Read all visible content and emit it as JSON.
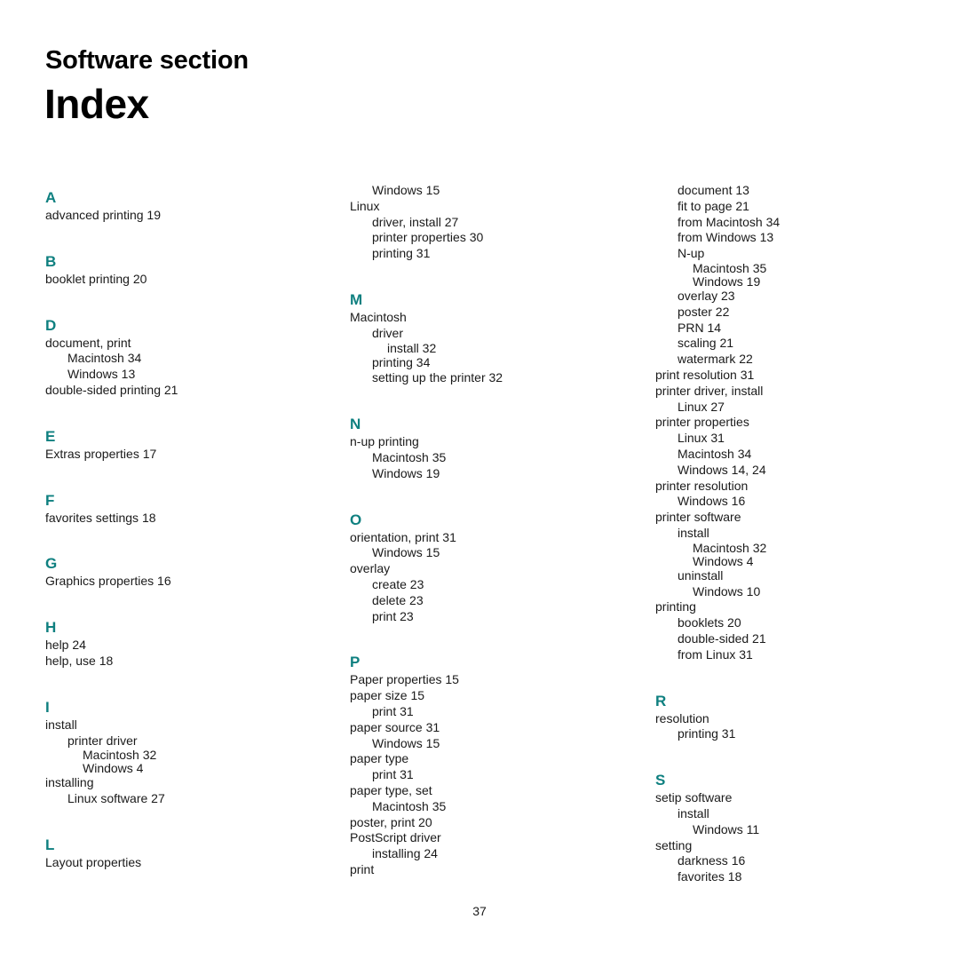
{
  "header": {
    "section_title": "Software section",
    "page_title": "Index"
  },
  "accent_color": "#0f8080",
  "columns": [
    {
      "blocks": [
        {
          "letter": "A",
          "gap_before": 0,
          "entries": [
            {
              "level": 1,
              "text": "advanced printing 19"
            }
          ]
        },
        {
          "letter": "B",
          "gap_before": 22,
          "entries": [
            {
              "level": 1,
              "text": "booklet printing 20"
            }
          ]
        },
        {
          "letter": "D",
          "gap_before": 22,
          "entries": [
            {
              "level": 1,
              "text": "document, print"
            },
            {
              "level": 2,
              "text": "Macintosh 34"
            },
            {
              "level": 2,
              "text": "Windows 13"
            },
            {
              "level": 1,
              "text": "double-sided printing 21"
            }
          ]
        },
        {
          "letter": "E",
          "gap_before": 22,
          "entries": [
            {
              "level": 1,
              "text": "Extras properties 17"
            }
          ]
        },
        {
          "letter": "F",
          "gap_before": 22,
          "entries": [
            {
              "level": 1,
              "text": "favorites settings 18"
            }
          ]
        },
        {
          "letter": "G",
          "gap_before": 22,
          "entries": [
            {
              "level": 1,
              "text": "Graphics properties 16"
            }
          ]
        },
        {
          "letter": "H",
          "gap_before": 22,
          "entries": [
            {
              "level": 1,
              "text": "help 24"
            },
            {
              "level": 1,
              "text": "help, use 18"
            }
          ]
        },
        {
          "letter": "I",
          "gap_before": 22,
          "entries": [
            {
              "level": 1,
              "text": "install"
            },
            {
              "level": 2,
              "text": "printer driver"
            },
            {
              "level": 3,
              "text": "Macintosh 32",
              "tight": true
            },
            {
              "level": 3,
              "text": "Windows 4",
              "tight": true
            },
            {
              "level": 1,
              "text": "installing"
            },
            {
              "level": 2,
              "text": "Linux software 27"
            }
          ]
        },
        {
          "letter": "L",
          "gap_before": 22,
          "entries": [
            {
              "level": 1,
              "text": "Layout properties"
            }
          ]
        }
      ]
    },
    {
      "blocks": [
        {
          "letter": "",
          "gap_before": 0,
          "entries": [
            {
              "level": 2,
              "text": "Windows 15"
            },
            {
              "level": 1,
              "text": "Linux"
            },
            {
              "level": 2,
              "text": "driver, install 27"
            },
            {
              "level": 2,
              "text": "printer properties 30"
            },
            {
              "level": 2,
              "text": "printing 31"
            }
          ]
        },
        {
          "letter": "M",
          "gap_before": 22,
          "entries": [
            {
              "level": 1,
              "text": "Macintosh"
            },
            {
              "level": 2,
              "text": "driver"
            },
            {
              "level": 3,
              "text": "install 32",
              "tight": true
            },
            {
              "level": 2,
              "text": "printing 34"
            },
            {
              "level": 2,
              "text": "setting up the printer 32"
            }
          ]
        },
        {
          "letter": "N",
          "gap_before": 22,
          "entries": [
            {
              "level": 1,
              "text": "n-up printing"
            },
            {
              "level": 2,
              "text": "Macintosh 35"
            },
            {
              "level": 2,
              "text": "Windows 19"
            }
          ]
        },
        {
          "letter": "O",
          "gap_before": 22,
          "entries": [
            {
              "level": 1,
              "text": "orientation, print 31"
            },
            {
              "level": 2,
              "text": "Windows 15"
            },
            {
              "level": 1,
              "text": "overlay"
            },
            {
              "level": 2,
              "text": "create 23"
            },
            {
              "level": 2,
              "text": "delete 23"
            },
            {
              "level": 2,
              "text": "print 23"
            }
          ]
        },
        {
          "letter": "P",
          "gap_before": 22,
          "entries": [
            {
              "level": 1,
              "text": "Paper properties 15"
            },
            {
              "level": 1,
              "text": "paper size 15"
            },
            {
              "level": 2,
              "text": "print 31"
            },
            {
              "level": 1,
              "text": "paper source 31"
            },
            {
              "level": 2,
              "text": "Windows 15"
            },
            {
              "level": 1,
              "text": "paper type"
            },
            {
              "level": 2,
              "text": "print 31"
            },
            {
              "level": 1,
              "text": "paper type, set"
            },
            {
              "level": 2,
              "text": "Macintosh 35"
            },
            {
              "level": 1,
              "text": "poster, print 20"
            },
            {
              "level": 1,
              "text": "PostScript driver"
            },
            {
              "level": 2,
              "text": "installing 24"
            },
            {
              "level": 1,
              "text": "print"
            }
          ]
        }
      ]
    },
    {
      "blocks": [
        {
          "letter": "",
          "gap_before": 0,
          "entries": [
            {
              "level": 2,
              "text": "document 13"
            },
            {
              "level": 2,
              "text": "fit to page 21"
            },
            {
              "level": 2,
              "text": "from Macintosh 34"
            },
            {
              "level": 2,
              "text": "from Windows 13"
            },
            {
              "level": 2,
              "text": "N-up"
            },
            {
              "level": 3,
              "text": "Macintosh 35",
              "tight": true
            },
            {
              "level": 3,
              "text": "Windows 19",
              "tight": true
            },
            {
              "level": 2,
              "text": "overlay 23"
            },
            {
              "level": 2,
              "text": "poster 22"
            },
            {
              "level": 2,
              "text": "PRN 14"
            },
            {
              "level": 2,
              "text": "scaling 21"
            },
            {
              "level": 2,
              "text": "watermark 22"
            },
            {
              "level": 1,
              "text": "print resolution 31"
            },
            {
              "level": 1,
              "text": "printer driver, install"
            },
            {
              "level": 2,
              "text": "Linux 27"
            },
            {
              "level": 1,
              "text": "printer properties"
            },
            {
              "level": 2,
              "text": "Linux 31"
            },
            {
              "level": 2,
              "text": "Macintosh 34"
            },
            {
              "level": 2,
              "text": "Windows 14, 24"
            },
            {
              "level": 1,
              "text": "printer resolution"
            },
            {
              "level": 2,
              "text": "Windows 16"
            },
            {
              "level": 1,
              "text": "printer software"
            },
            {
              "level": 2,
              "text": "install"
            },
            {
              "level": 3,
              "text": "Macintosh 32",
              "tight": true
            },
            {
              "level": 3,
              "text": "Windows 4",
              "tight": true
            },
            {
              "level": 2,
              "text": "uninstall"
            },
            {
              "level": 3,
              "text": "Windows 10"
            },
            {
              "level": 1,
              "text": "printing"
            },
            {
              "level": 2,
              "text": "booklets 20"
            },
            {
              "level": 2,
              "text": "double-sided 21"
            },
            {
              "level": 2,
              "text": "from Linux 31"
            }
          ]
        },
        {
          "letter": "R",
          "gap_before": 22,
          "entries": [
            {
              "level": 1,
              "text": "resolution"
            },
            {
              "level": 2,
              "text": "printing 31"
            }
          ]
        },
        {
          "letter": "S",
          "gap_before": 22,
          "entries": [
            {
              "level": 1,
              "text": "setip software"
            },
            {
              "level": 2,
              "text": "install"
            },
            {
              "level": 3,
              "text": "Windows 11"
            },
            {
              "level": 1,
              "text": "setting"
            },
            {
              "level": 2,
              "text": "darkness 16"
            },
            {
              "level": 2,
              "text": "favorites 18"
            }
          ]
        }
      ]
    }
  ],
  "footer": {
    "page_number": "37"
  }
}
